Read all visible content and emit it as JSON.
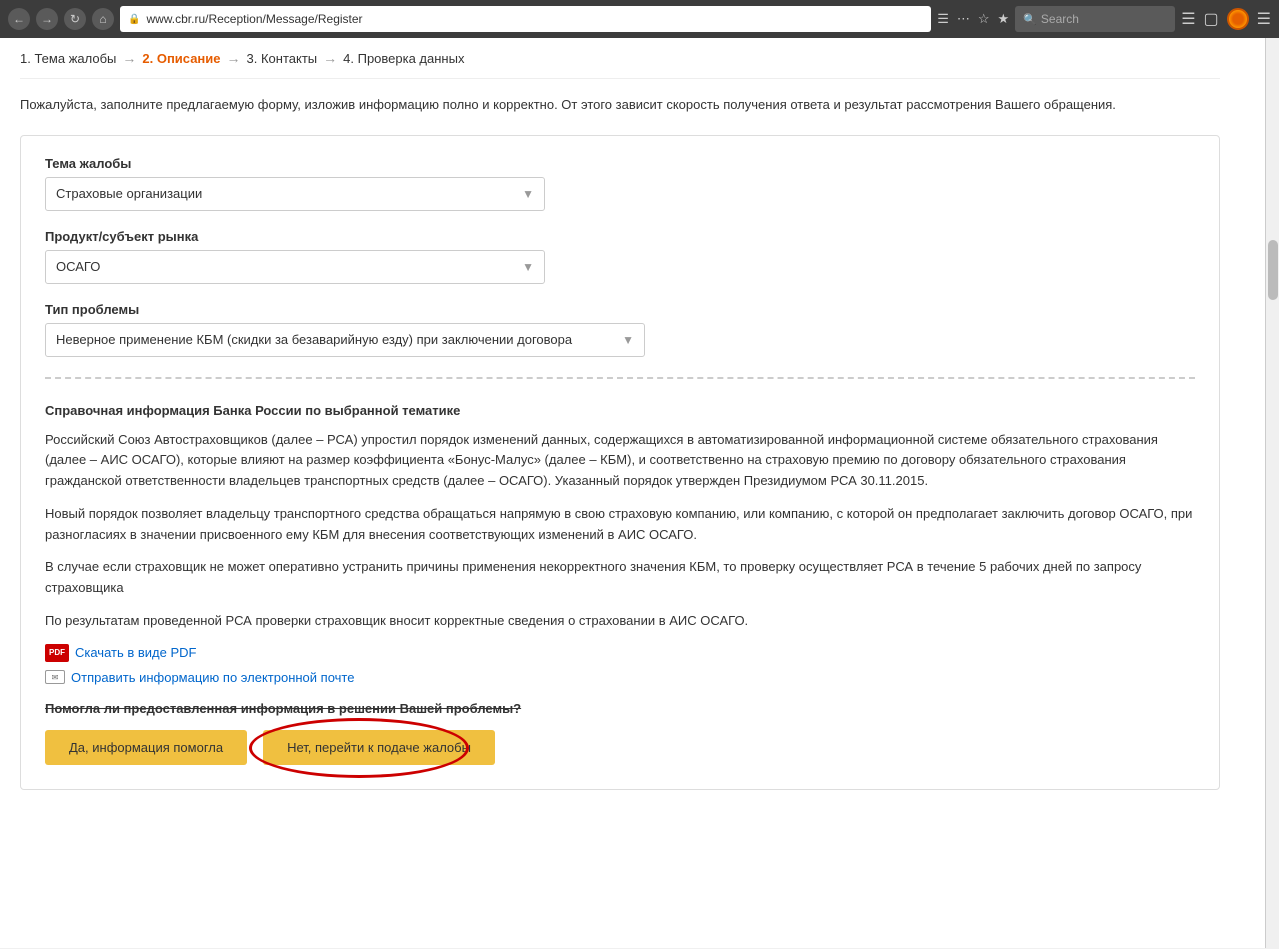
{
  "browser": {
    "url": "www.cbr.ru/Reception/Message/Register",
    "search_placeholder": "Search"
  },
  "steps": [
    {
      "num": "1.",
      "label": "Тема жалобы",
      "active": false
    },
    {
      "num": "2.",
      "label": "Описание",
      "active": true
    },
    {
      "num": "3.",
      "label": "Контакты",
      "active": false
    },
    {
      "num": "4.",
      "label": "Проверка данных",
      "active": false
    }
  ],
  "intro_text": "Пожалуйста, заполните предлагаемую форму, изложив информацию полно и корректно. От этого зависит скорость получения ответа и результат рассмотрения Вашего обращения.",
  "form": {
    "field1_label": "Тема жалобы",
    "field1_value": "Страховые организации",
    "field2_label": "Продукт/субъект рынка",
    "field2_value": "ОСАГО",
    "field3_label": "Тип проблемы",
    "field3_value": "Неверное применение КБМ (скидки за безаварийную езду) при заключении договора"
  },
  "info_section": {
    "title": "Справочная информация Банка России по выбранной тематике",
    "paragraphs": [
      "Российский Союз Автостраховщиков (далее – РСА) упростил порядок изменений данных, содержащихся в автоматизированной информационной системе обязательного страхования (далее – АИС ОСАГО), которые влияют на размер коэффициента «Бонус-Малус» (далее – КБМ), и соответственно на страховую премию по договору обязательного страхования гражданской ответственности владельцев транспортных средств (далее – ОСАГО). Указанный порядок утвержден Президиумом РСА 30.11.2015.",
      "Новый порядок позволяет владельцу транспортного средства обращаться напрямую в свою страховую компанию, или компанию, с которой он предполагает заключить договор ОСАГО, при разногласиях в значении присвоенного ему КБМ для внесения соответствующих изменений в АИС ОСАГО.",
      "В случае если страховщик не может оперативно устранить причины применения некорректного значения КБМ, то проверку осуществляет РСА в течение 5 рабочих дней по запросу страховщика",
      "По результатам проведенной РСА проверки страховщик вносит корректные сведения о страховании в АИС ОСАГО."
    ],
    "pdf_link_text": "Скачать в виде PDF",
    "email_link_text": "Отправить информацию по электронной почте"
  },
  "question": {
    "text": "Помогла ли предоставленная информация в решении Вашей проблемы?",
    "btn_yes": "Да, информация помогла",
    "btn_no": "Нет, перейти к подаче жалобы"
  }
}
